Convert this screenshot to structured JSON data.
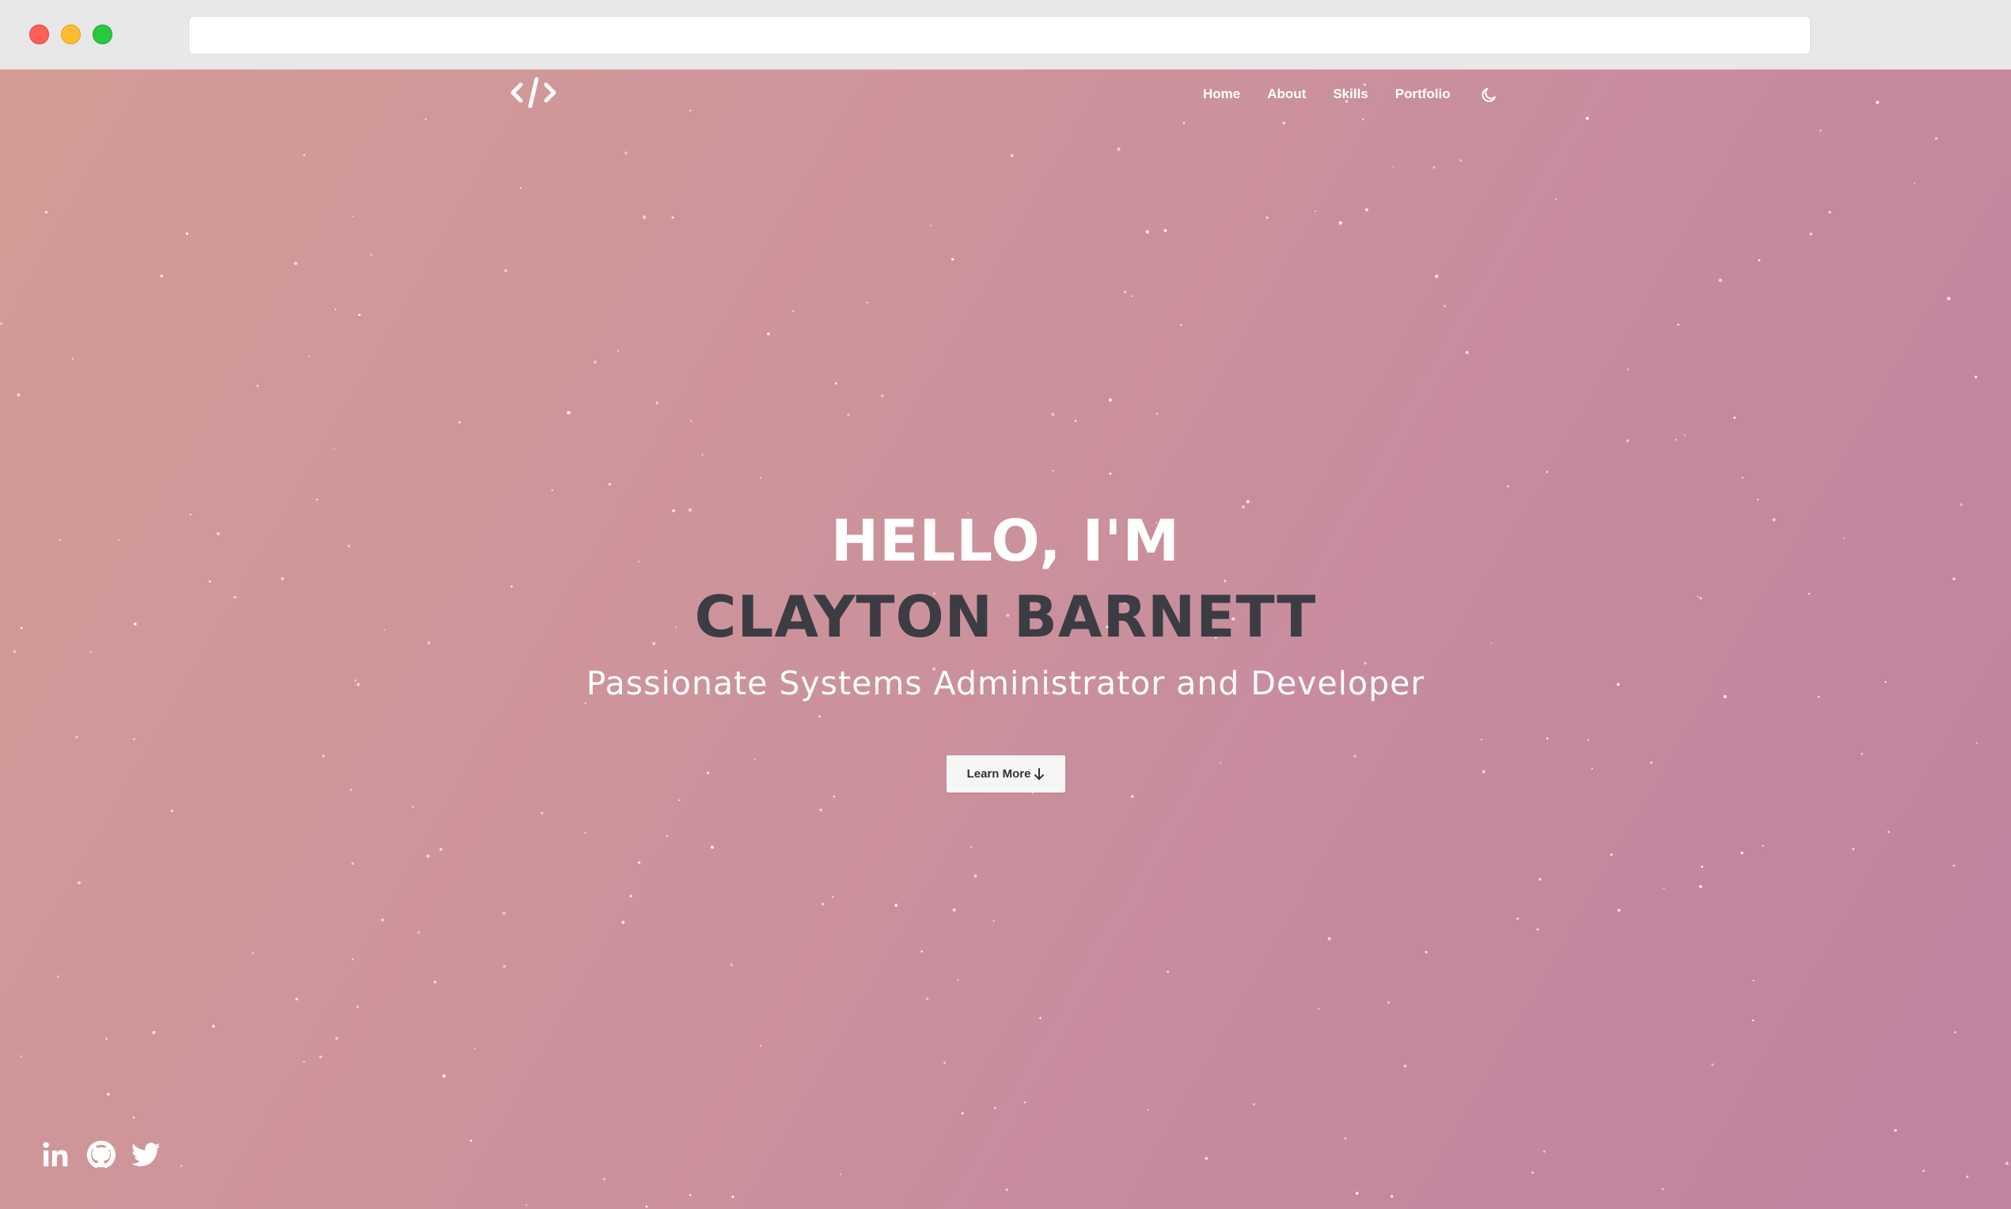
{
  "browser": {
    "address": ""
  },
  "nav": {
    "links": [
      {
        "label": "Home"
      },
      {
        "label": "About"
      },
      {
        "label": "Skills"
      },
      {
        "label": "Portfolio"
      }
    ],
    "theme_toggle_icon": "moon-icon",
    "logo_icon": "code-brackets-icon"
  },
  "hero": {
    "greeting": "HELLO, I'M",
    "name": "CLAYTON BARNETT",
    "subtitle": "Passionate Systems Administrator and Developer",
    "cta_label": "Learn More",
    "cta_icon": "arrow-down-icon"
  },
  "socials": [
    {
      "icon": "linkedin-icon"
    },
    {
      "icon": "github-icon"
    },
    {
      "icon": "twitter-icon"
    }
  ],
  "colors": {
    "gradient_start": "#d39c96",
    "gradient_end": "#c083a1",
    "name_text": "#3c3c44",
    "white": "#ffffff"
  }
}
